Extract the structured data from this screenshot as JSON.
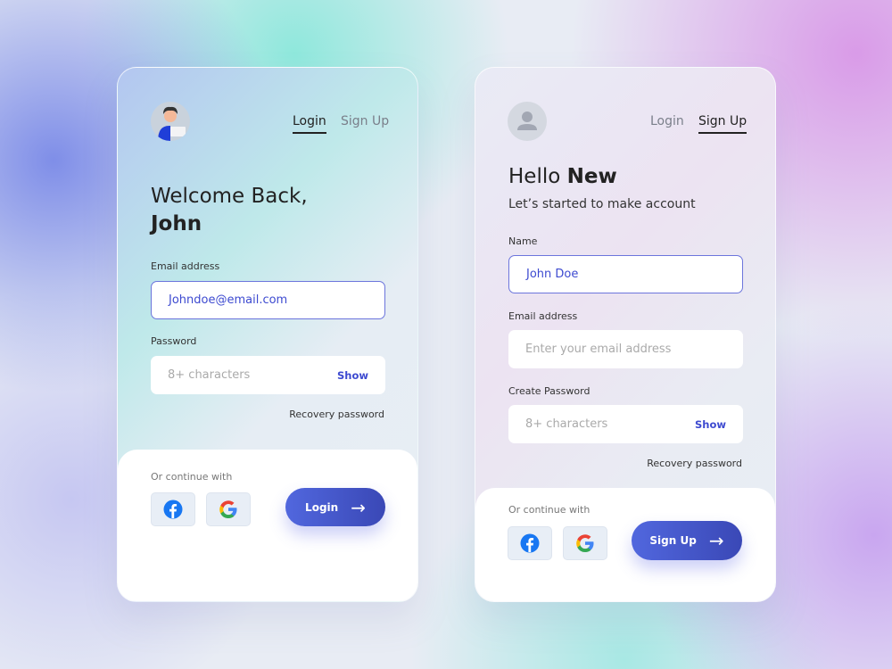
{
  "colors": {
    "accent": "#3d4ad0",
    "button": "#4a5ad0"
  },
  "login_card": {
    "tabs": [
      {
        "label": "Login",
        "active": true
      },
      {
        "label": "Sign Up",
        "active": false
      }
    ],
    "greeting": "Welcome Back,",
    "name": "John",
    "email": {
      "label": "Email address",
      "value": "Johndoe@email.com"
    },
    "password": {
      "label": "Password",
      "placeholder": "8+ characters",
      "show": "Show"
    },
    "recovery": "Recovery password",
    "continue_with": "Or continue with",
    "submit": "Login"
  },
  "signup_card": {
    "tabs": [
      {
        "label": "Login",
        "active": false
      },
      {
        "label": "Sign Up",
        "active": true
      }
    ],
    "greeting": "Hello",
    "greeting_bold": "New",
    "subtitle": "Let’s started to make account",
    "name": {
      "label": "Name",
      "value": "John Doe"
    },
    "email": {
      "label": "Email address",
      "placeholder": "Enter your email address"
    },
    "password": {
      "label": "Create Password",
      "placeholder": "8+ characters",
      "show": "Show"
    },
    "recovery": "Recovery password",
    "continue_with": "Or continue with",
    "submit": "Sign Up"
  }
}
